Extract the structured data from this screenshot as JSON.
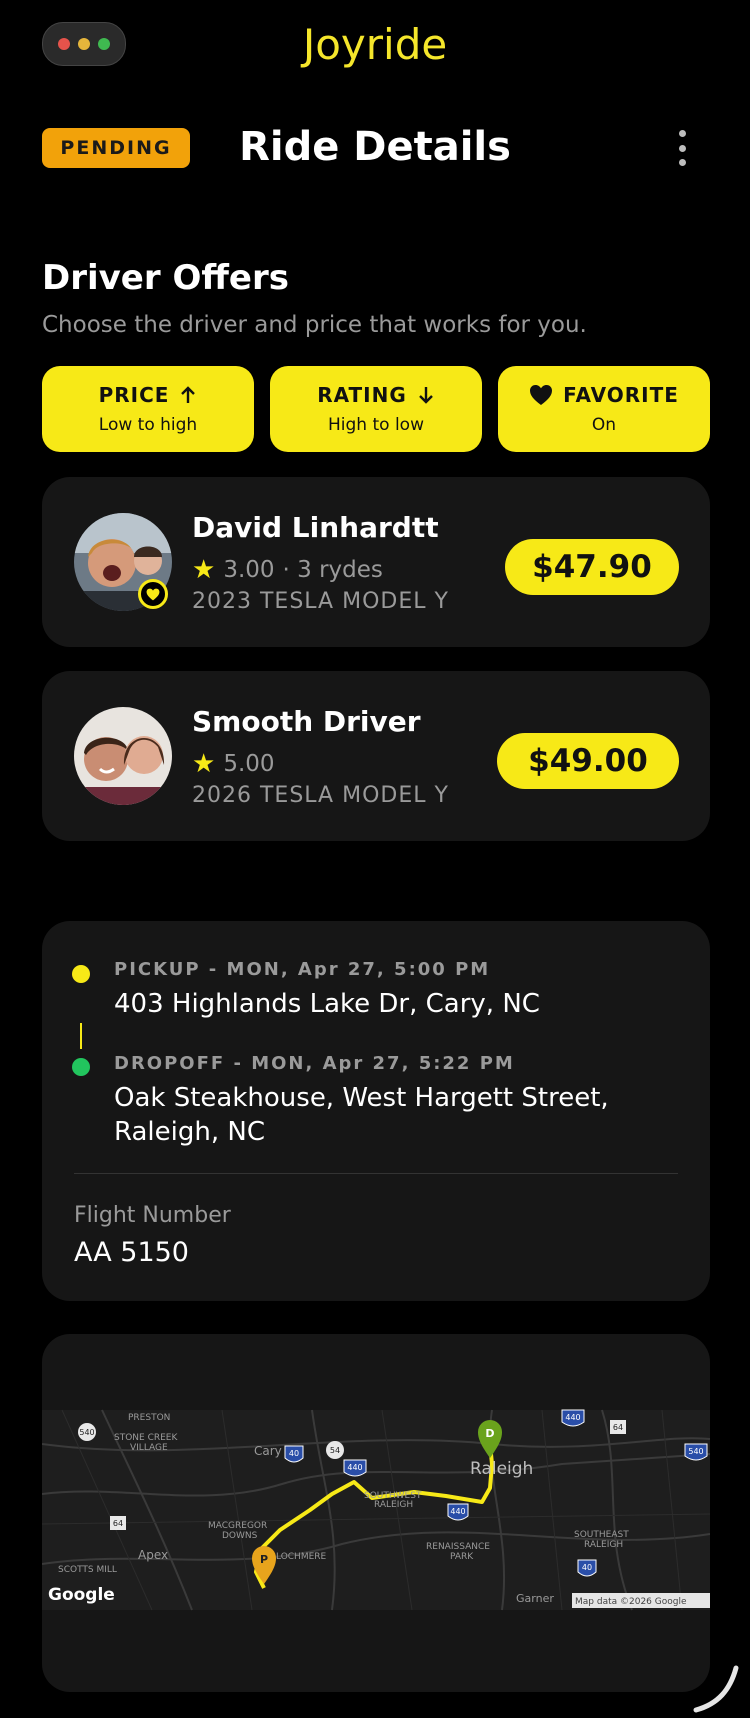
{
  "app": {
    "title": "Joyride"
  },
  "header": {
    "status_badge": "PENDING",
    "title": "Ride Details"
  },
  "offers_section": {
    "title": "Driver Offers",
    "subtitle": "Choose the driver and price that works for you."
  },
  "filters": [
    {
      "title": "PRICE",
      "subtitle": "Low to high",
      "icon": "arrow-up-icon"
    },
    {
      "title": "RATING",
      "subtitle": "High to low",
      "icon": "arrow-down-icon"
    },
    {
      "title": "FAVORITE",
      "subtitle": "On",
      "icon": "heart-icon"
    }
  ],
  "offers": [
    {
      "name": "David Linhardtt",
      "rating": "3.00",
      "rydes": "· 3 rydes",
      "car": "2023 TESLA MODEL Y",
      "price": "$47.90",
      "favorite": true
    },
    {
      "name": "Smooth Driver",
      "rating": "5.00",
      "rydes": "",
      "car": "2026 TESLA MODEL Y",
      "price": "$49.00",
      "favorite": false
    }
  ],
  "trip": {
    "pickup_label": "PICKUP - MON, Apr 27, 5:00 PM",
    "pickup_address": "403 Highlands Lake Dr, Cary, NC",
    "dropoff_label": "DROPOFF - MON, Apr 27, 5:22 PM",
    "dropoff_address": "Oak Steakhouse, West Hargett Street, Raleigh, NC",
    "flight_label": "Flight Number",
    "flight_number": "AA 5150"
  },
  "map": {
    "labels": {
      "preston": "PRESTON",
      "stone_creek": "STONE CREEK",
      "village": "VILLAGE",
      "cary": "Cary",
      "raleigh": "Raleigh",
      "southwest": "SOUTHWEST",
      "sw_raleigh": "RALEIGH",
      "macgregor": "MACGREGOR",
      "downs": "DOWNS",
      "lochmere": "LOCHMERE",
      "apex": "Apex",
      "scotts_mill": "SCOTTS MILL",
      "renaissance": "RENAISSANCE",
      "park": "PARK",
      "southeast": "SOUTHEAST",
      "se_raleigh": "RALEIGH",
      "garner": "Garner"
    },
    "shields": [
      "540",
      "40",
      "54",
      "440",
      "440",
      "64",
      "540",
      "440",
      "40",
      "64"
    ],
    "pickup_marker": "P",
    "dropoff_marker": "D",
    "google": "Google",
    "attribution": "Map data ©2026 Google"
  },
  "colors": {
    "accent": "#f7e917",
    "badge": "#f2a20a",
    "card": "#161616",
    "pickup": "#f7e917",
    "dropoff": "#22c55e"
  }
}
